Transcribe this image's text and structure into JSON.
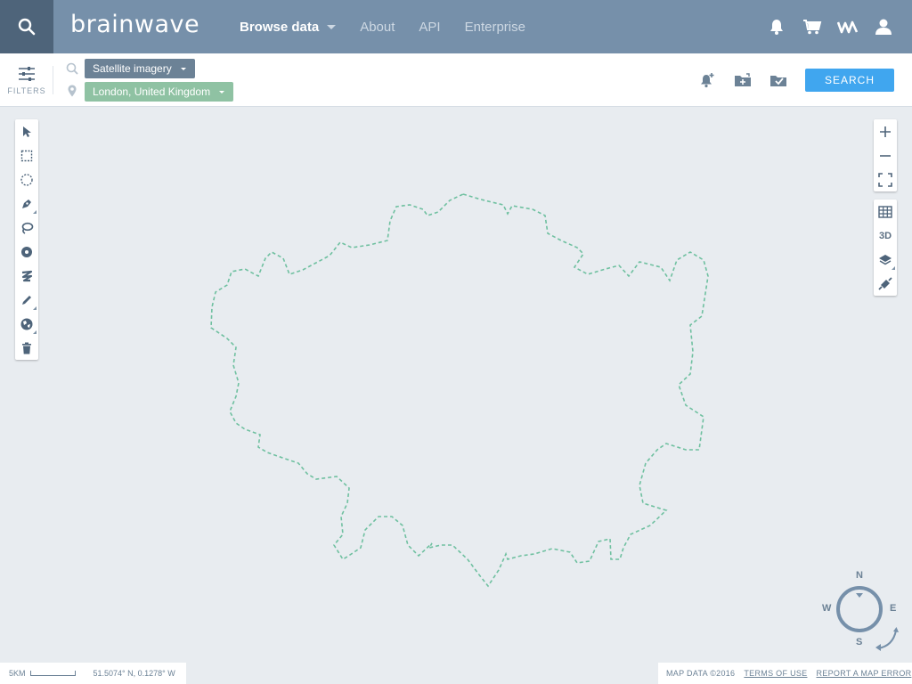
{
  "topbar": {
    "logo": "brainwave",
    "nav": [
      {
        "label": "Browse data",
        "active": true,
        "has_caret": true
      },
      {
        "label": "About",
        "active": false
      },
      {
        "label": "API",
        "active": false
      },
      {
        "label": "Enterprise",
        "active": false
      }
    ],
    "icons": [
      "search-icon",
      "bell-icon",
      "cart-icon",
      "brand-mark-icon",
      "user-icon"
    ]
  },
  "filterbar": {
    "filters_label": "FILTERS",
    "data_type_tag": "Satellite imagery",
    "location_tag": "London, United Kingdom",
    "actions": [
      "add-alert-icon",
      "save-folder-icon",
      "download-folder-icon"
    ],
    "search_label": "SEARCH"
  },
  "map": {
    "left_tools": [
      "select-arrow-icon",
      "rectangle-select-icon",
      "circle-select-icon",
      "pen-icon",
      "lasso-icon",
      "point-radius-icon",
      "freehand-icon",
      "edit-pencil-icon",
      "globe-icon",
      "trash-icon"
    ],
    "zoom_tools": [
      "zoom-in-icon",
      "zoom-out-icon",
      "fullscreen-icon"
    ],
    "view_tools": [
      "grid-icon",
      "3d-toggle",
      "layers-icon",
      "satellite-icon"
    ],
    "view_3d_label": "3D",
    "compass": {
      "n": "N",
      "e": "E",
      "s": "S",
      "w": "W"
    },
    "boundary_color": "#6fc0a0"
  },
  "footer": {
    "scale_label": "5KM",
    "coordinates": "51.5074° N, 0.1278° W",
    "map_data": "MAP DATA ©2016",
    "terms": "TERMS OF USE",
    "report": "REPORT A MAP ERROR"
  }
}
